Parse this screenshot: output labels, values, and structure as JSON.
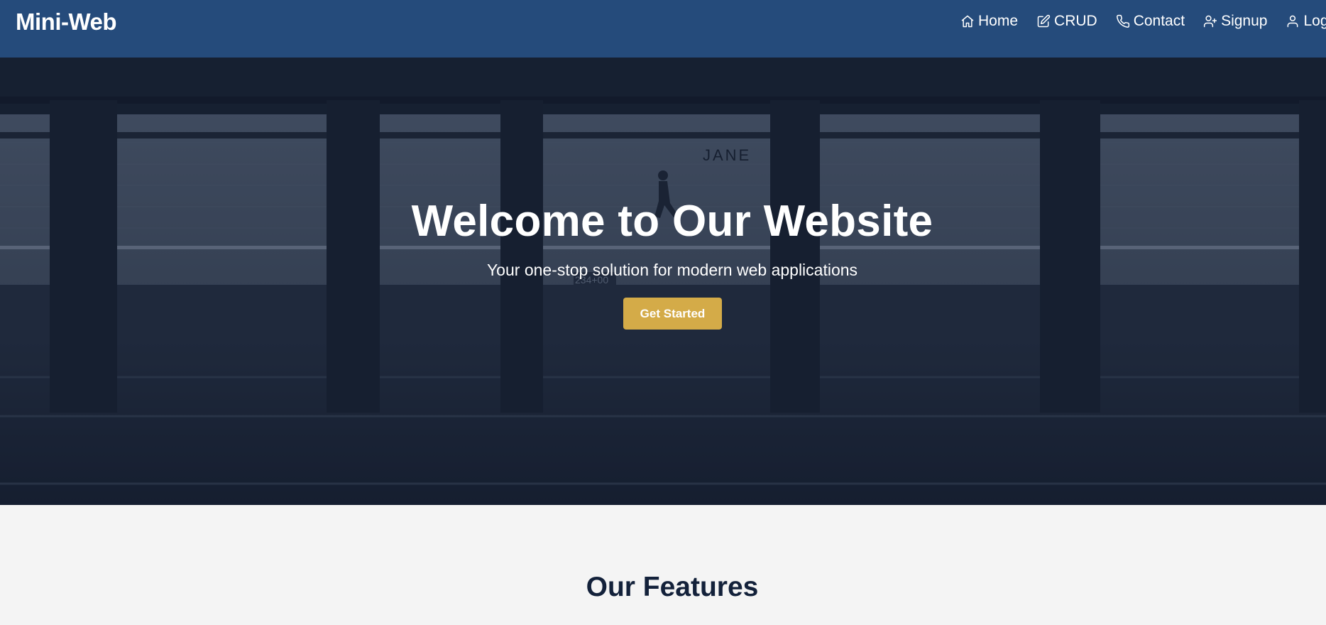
{
  "header": {
    "brand": "Mini-Web",
    "background": "#254b7b",
    "nav": [
      {
        "label": "Home",
        "icon": "home-icon"
      },
      {
        "label": "CRUD",
        "icon": "edit-icon"
      },
      {
        "label": "Contact",
        "icon": "phone-icon"
      },
      {
        "label": "Signup",
        "icon": "user-plus-icon"
      },
      {
        "label": "Login",
        "icon": "user-icon"
      }
    ]
  },
  "hero": {
    "title": "Welcome to Our Website",
    "subtitle": "Your one-stop solution for modern web applications",
    "cta_label": "Get Started",
    "cta_color": "#d4ab48",
    "background_image": "subway-station-platform-photo",
    "signage": {
      "station": "JANE",
      "marker": "234+00"
    }
  },
  "features": {
    "title": "Our Features",
    "title_color": "#13213a"
  }
}
